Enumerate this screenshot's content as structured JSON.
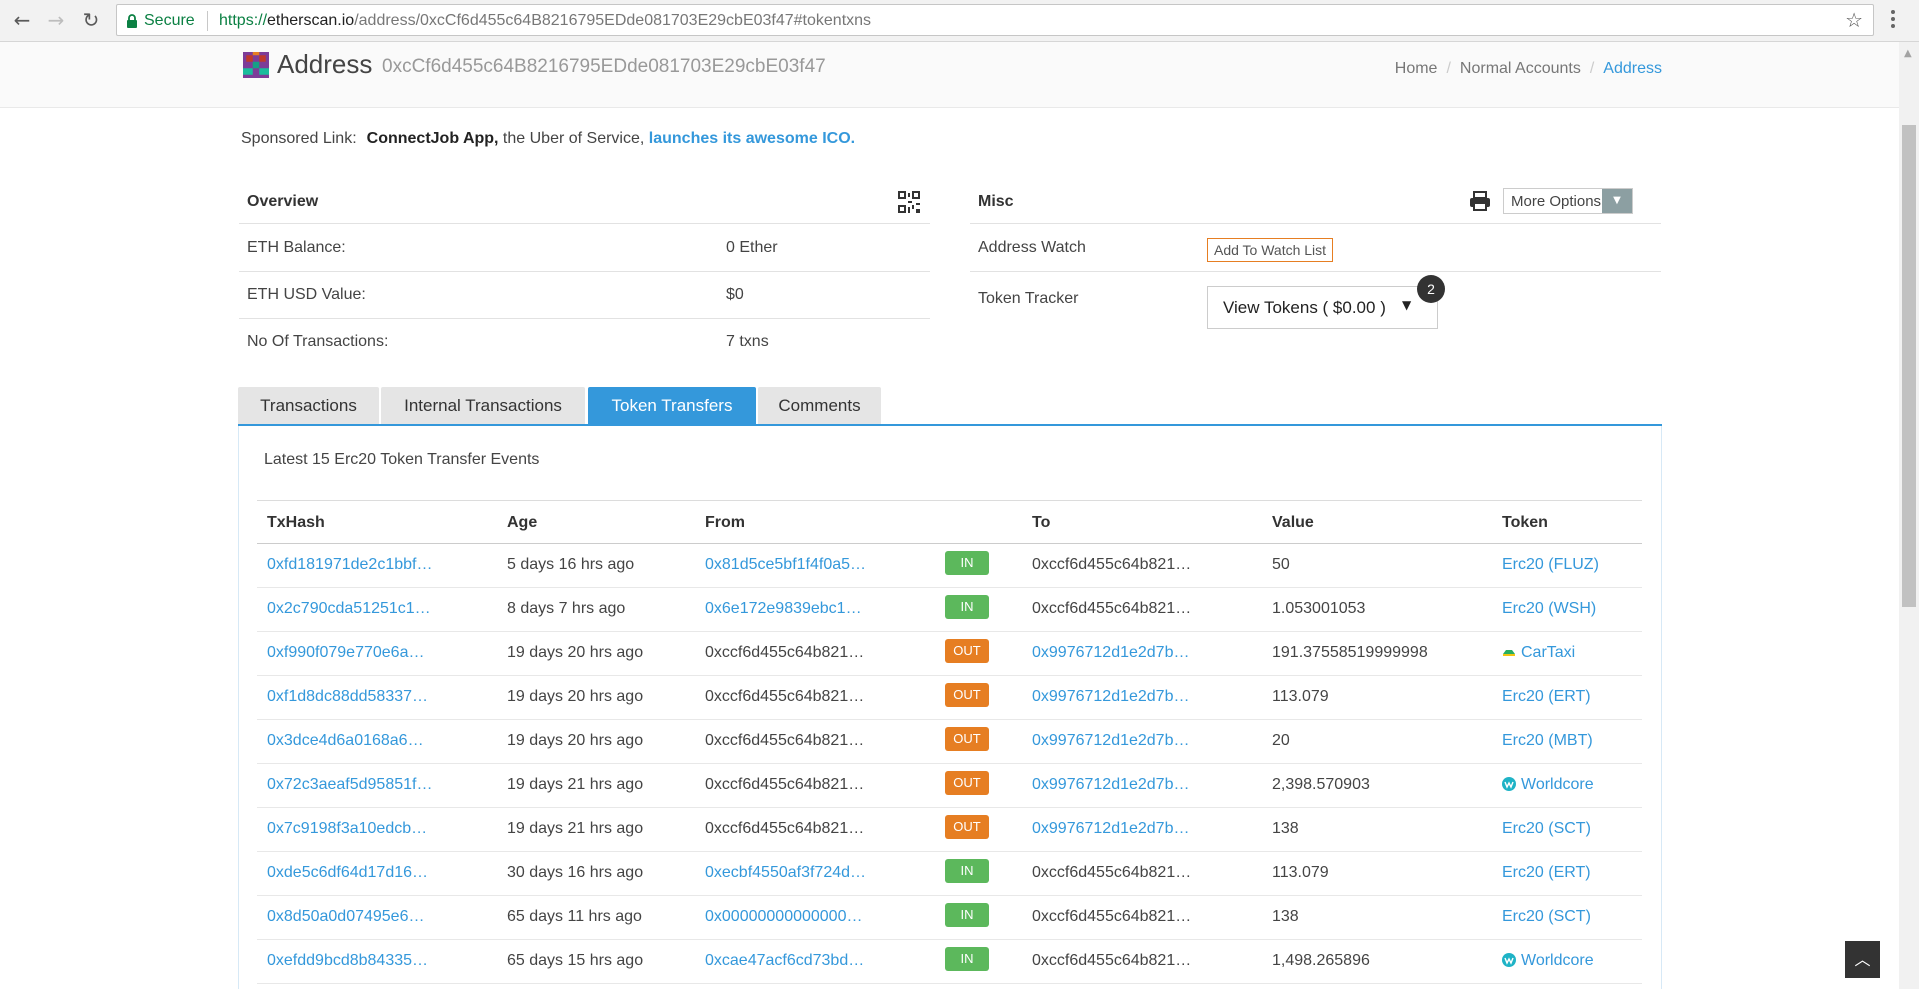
{
  "browser": {
    "secure_label": "Secure",
    "url_scheme": "https://",
    "url_host": "etherscan.io",
    "url_path": "/address/0xcCf6d455c64B8216795EDde081703E29cbE03f47#tokentxns"
  },
  "header": {
    "title": "Address",
    "address": "0xcCf6d455c64B8216795EDde081703E29cbE03f47",
    "breadcrumb": [
      "Home",
      "Normal Accounts",
      "Address"
    ]
  },
  "sponsored": {
    "label": "Sponsored Link:",
    "name": "ConnectJob App,",
    "text": " the Uber of Service, ",
    "link": "launches its awesome ICO."
  },
  "overview": {
    "title": "Overview",
    "rows": [
      {
        "label": "ETH Balance:",
        "value": "0 Ether"
      },
      {
        "label": "ETH USD Value:",
        "value": "$0"
      },
      {
        "label": "No Of Transactions:",
        "value": "7 txns"
      }
    ]
  },
  "misc": {
    "title": "Misc",
    "more_options": "More Options",
    "address_watch_label": "Address Watch",
    "add_watch_button": "Add To Watch List",
    "token_tracker_label": "Token Tracker",
    "view_tokens_button": "View Tokens ( $0.00 )",
    "token_count": "2"
  },
  "tabs": [
    "Transactions",
    "Internal Transactions",
    "Token Transfers",
    "Comments"
  ],
  "active_tab": "Token Transfers",
  "transfers": {
    "caption": "Latest 15 Erc20 Token Transfer Events",
    "columns": [
      "TxHash",
      "Age",
      "From",
      "To",
      "Value",
      "Token"
    ],
    "rows": [
      {
        "hash": "0xfd181971de2c1bbf…",
        "age": "5 days 16 hrs ago",
        "from": "0x81d5ce5bf1f4f0a5…",
        "dir": "IN",
        "to": "0xccf6d455c64b821…",
        "value": "50",
        "token": "Erc20 (FLUZ)",
        "icon": ""
      },
      {
        "hash": "0x2c790cda51251c1…",
        "age": "8 days 7 hrs ago",
        "from": "0x6e172e9839ebc1…",
        "dir": "IN",
        "to": "0xccf6d455c64b821…",
        "value": "1.053001053",
        "token": "Erc20 (WSH)",
        "icon": ""
      },
      {
        "hash": "0xf990f079e770e6a…",
        "age": "19 days 20 hrs ago",
        "from": "0xccf6d455c64b821…",
        "dir": "OUT",
        "to": "0x9976712d1e2d7b…",
        "value": "191.37558519999998",
        "token": "CarTaxi",
        "icon": "cartaxi-icon"
      },
      {
        "hash": "0xf1d8dc88dd58337…",
        "age": "19 days 20 hrs ago",
        "from": "0xccf6d455c64b821…",
        "dir": "OUT",
        "to": "0x9976712d1e2d7b…",
        "value": "113.079",
        "token": "Erc20 (ERT)",
        "icon": ""
      },
      {
        "hash": "0x3dce4d6a0168a6…",
        "age": "19 days 20 hrs ago",
        "from": "0xccf6d455c64b821…",
        "dir": "OUT",
        "to": "0x9976712d1e2d7b…",
        "value": "20",
        "token": "Erc20 (MBT)",
        "icon": ""
      },
      {
        "hash": "0x72c3aeaf5d95851f…",
        "age": "19 days 21 hrs ago",
        "from": "0xccf6d455c64b821…",
        "dir": "OUT",
        "to": "0x9976712d1e2d7b…",
        "value": "2,398.570903",
        "token": "Worldcore",
        "icon": "worldcore-icon"
      },
      {
        "hash": "0x7c9198f3a10edcb…",
        "age": "19 days 21 hrs ago",
        "from": "0xccf6d455c64b821…",
        "dir": "OUT",
        "to": "0x9976712d1e2d7b…",
        "value": "138",
        "token": "Erc20 (SCT)",
        "icon": ""
      },
      {
        "hash": "0xde5c6df64d17d16…",
        "age": "30 days 16 hrs ago",
        "from": "0xecbf4550af3f724d…",
        "dir": "IN",
        "to": "0xccf6d455c64b821…",
        "value": "113.079",
        "token": "Erc20 (ERT)",
        "icon": ""
      },
      {
        "hash": "0x8d50a0d07495e6…",
        "age": "65 days 11 hrs ago",
        "from": "0x00000000000000…",
        "dir": "IN",
        "to": "0xccf6d455c64b821…",
        "value": "138",
        "token": "Erc20 (SCT)",
        "icon": ""
      },
      {
        "hash": "0xefdd9bcd8b84335…",
        "age": "65 days 15 hrs ago",
        "from": "0xcae47acf6cd73bd…",
        "dir": "IN",
        "to": "0xccf6d455c64b821…",
        "value": "1,498.265896",
        "token": "Worldcore",
        "icon": "worldcore-icon"
      }
    ]
  },
  "colors": {
    "link": "#3498db",
    "in": "#5cb85c",
    "out": "#e67e22",
    "tab_active": "#3498db"
  }
}
